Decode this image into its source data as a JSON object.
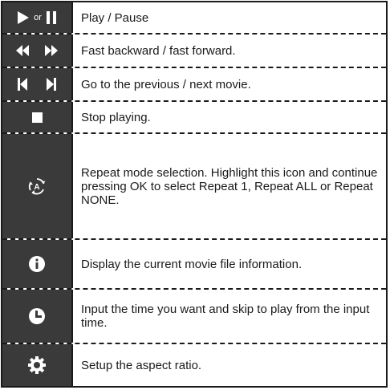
{
  "rows": [
    {
      "icon": "play-or-pause-icon",
      "or_text": "or",
      "text": "Play / Pause"
    },
    {
      "icon": "rewind-fast-forward-icon",
      "text": "Fast backward / fast forward."
    },
    {
      "icon": "previous-next-icon",
      "text": "Go to the previous / next movie."
    },
    {
      "icon": "stop-icon",
      "text": "Stop playing."
    },
    {
      "icon": "repeat-mode-icon",
      "text": "Repeat mode selection. Highlight this icon and continue pressing OK to select Repeat 1, Repeat ALL or Repeat NONE."
    },
    {
      "icon": "info-icon",
      "text": "Display the current movie file information."
    },
    {
      "icon": "clock-icon",
      "text": "Input the time you want and skip to play from the input time."
    },
    {
      "icon": "gear-icon",
      "text": "Setup the aspect ratio."
    }
  ],
  "colors": {
    "icon_cell_bg": "#3a3a3a",
    "border": "#1a1a1a",
    "text": "#1a1a1a"
  }
}
